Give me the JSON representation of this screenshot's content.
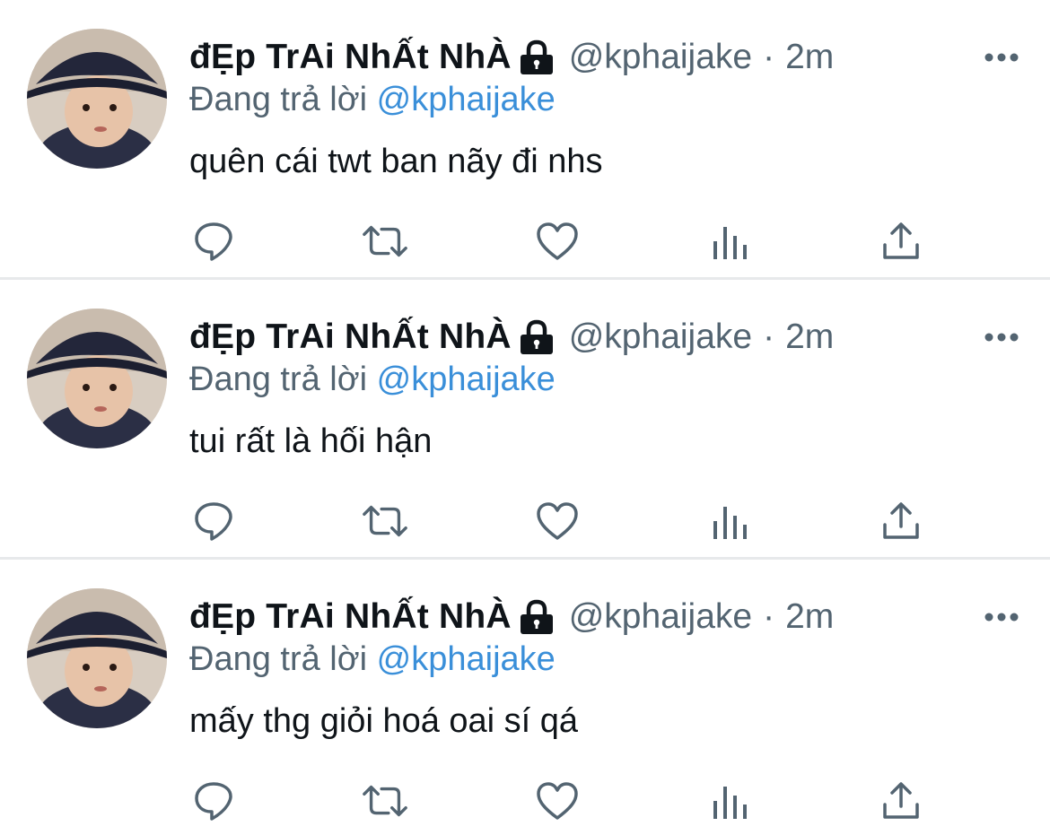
{
  "colors": {
    "primary_text": "#0f1419",
    "secondary_text": "#536471",
    "link": "#3a8fd9",
    "divider": "#e7e9eb",
    "icon": "#536471"
  },
  "icons": {
    "lock": "lock-icon",
    "more": "more-horizontal-icon",
    "reply": "reply-icon",
    "retweet": "retweet-icon",
    "like": "heart-icon",
    "analytics": "analytics-icon",
    "share": "share-icon"
  },
  "tweets": [
    {
      "display_name": "đẸp TrAi NhẤt NhÀ",
      "handle": "@kphaijake",
      "separator": "·",
      "time": "2m",
      "reply_prefix": "Đang trả lời",
      "reply_to": "@kphaijake",
      "text": "quên cái twt ban nãy đi nhs"
    },
    {
      "display_name": "đẸp TrAi NhẤt NhÀ",
      "handle": "@kphaijake",
      "separator": "·",
      "time": "2m",
      "reply_prefix": "Đang trả lời",
      "reply_to": "@kphaijake",
      "text": "tui rất là hối hận"
    },
    {
      "display_name": "đẸp TrAi NhẤt NhÀ",
      "handle": "@kphaijake",
      "separator": "·",
      "time": "2m",
      "reply_prefix": "Đang trả lời",
      "reply_to": "@kphaijake",
      "text": "mấy thg giỏi hoá oai sí qá"
    }
  ]
}
